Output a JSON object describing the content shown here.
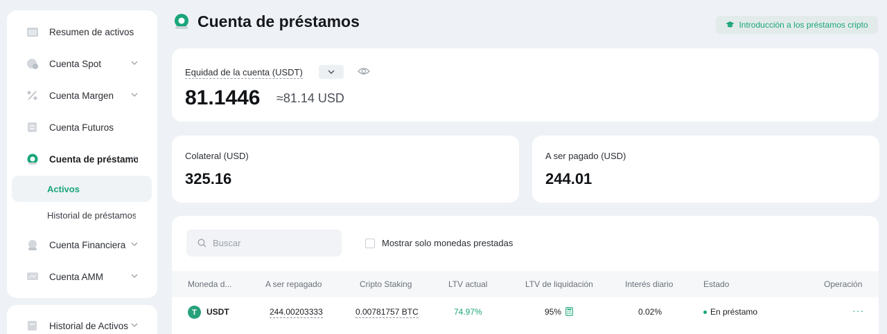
{
  "sidebar": {
    "items": [
      {
        "label": "Resumen de activos",
        "icon": "wallet-icon"
      },
      {
        "label": "Cuenta Spot",
        "icon": "spot-icon"
      },
      {
        "label": "Cuenta Margen",
        "icon": "percent-icon"
      },
      {
        "label": "Cuenta Futuros",
        "icon": "futures-icon"
      },
      {
        "label": "Cuenta de préstamos",
        "icon": "loan-icon"
      },
      {
        "label": "Cuenta Financiera",
        "icon": "finance-icon"
      },
      {
        "label": "Cuenta AMM",
        "icon": "amm-icon"
      }
    ],
    "subitems": [
      {
        "label": "Activos"
      },
      {
        "label": "Historial de préstamos"
      }
    ],
    "bottom_item": {
      "label": "Historial de Activos"
    }
  },
  "header": {
    "title": "Cuenta de préstamos",
    "intro_link": "Introducción a los préstamos cripto"
  },
  "equity": {
    "label": "Equidad de la cuenta (USDT)",
    "value": "81.1446",
    "usd": "≈81.14 USD"
  },
  "collateral": {
    "label": "Colateral (USD)",
    "value": "325.16"
  },
  "to_pay": {
    "label": "A ser pagado (USD)",
    "value": "244.01"
  },
  "table": {
    "search_placeholder": "Buscar",
    "checkbox_label": "Mostrar solo monedas prestadas",
    "columns": [
      "Moneda d...",
      "A ser repagado",
      "Cripto Staking",
      "LTV actual",
      "LTV de liquidación",
      "Interés diario",
      "Estado",
      "Operación"
    ],
    "rows": [
      {
        "coin": "USDT",
        "coin_symbol": "T",
        "repay": "244.00203333",
        "staking": "0.00781757 BTC",
        "ltv": "74.97%",
        "liq_ltv": "95%",
        "interest": "0.02%",
        "status": "En préstamo",
        "operation": "···"
      }
    ]
  },
  "colors": {
    "accent": "#1aa57a",
    "background": "#eef1f5",
    "card": "#ffffff"
  }
}
